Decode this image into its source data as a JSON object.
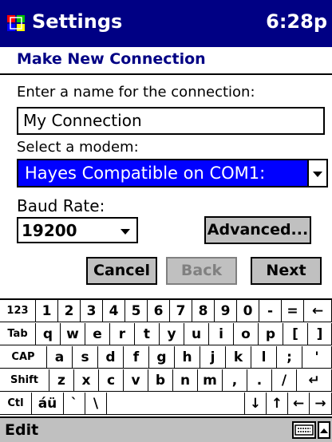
{
  "titlebar": {
    "app": "Settings",
    "clock": "6:28p"
  },
  "header": {
    "title": "Make New Connection"
  },
  "form": {
    "name_label": "Enter a name for the connection:",
    "name_value": "My Connection",
    "modem_label": "Select a modem:",
    "modem_value": "Hayes Compatible on COM1:",
    "baud_label": "Baud Rate:",
    "baud_value": "19200",
    "advanced": "Advanced...",
    "cancel": "Cancel",
    "back": "Back",
    "next": "Next"
  },
  "keyboard": {
    "rows": [
      [
        "123",
        "1",
        "2",
        "3",
        "4",
        "5",
        "6",
        "7",
        "8",
        "9",
        "0",
        "-",
        "=",
        "←"
      ],
      [
        "Tab",
        "q",
        "w",
        "e",
        "r",
        "t",
        "y",
        "u",
        "i",
        "o",
        "p",
        "[",
        "]"
      ],
      [
        "CAP",
        "a",
        "s",
        "d",
        "f",
        "g",
        "h",
        "j",
        "k",
        "l",
        ";",
        "'"
      ],
      [
        "Shift",
        "z",
        "x",
        "c",
        "v",
        "b",
        "n",
        "m",
        ",",
        ".",
        "/",
        "↵"
      ],
      [
        "Ctl",
        "áü",
        "`",
        "\\",
        "",
        "↓",
        "↑",
        "←",
        "→"
      ]
    ]
  },
  "footer": {
    "menu": "Edit"
  },
  "colors": {
    "titlebar": "#000084",
    "selection": "#0000ff",
    "button_face": "#c0c0c0"
  }
}
